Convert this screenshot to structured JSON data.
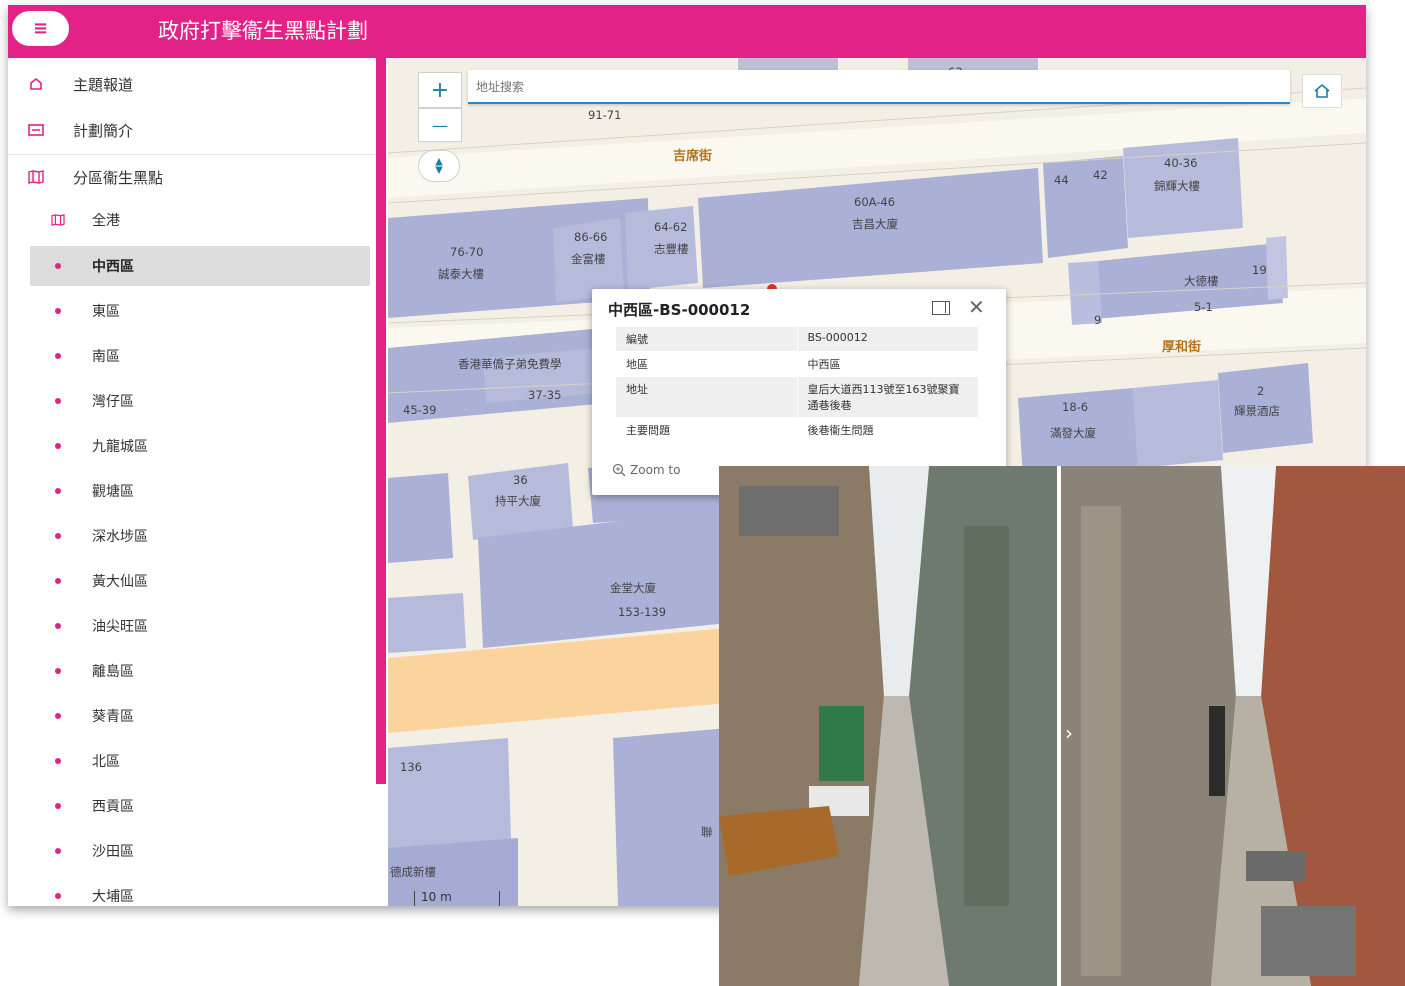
{
  "header": {
    "menu_icon": "hamburger-menu-icon",
    "title": "政府打擊衞生黑點計劃"
  },
  "sidebar": {
    "items": [
      {
        "label": "主題報道",
        "icon": "home-icon"
      },
      {
        "label": "計劃簡介",
        "icon": "card-icon"
      },
      {
        "label": "分區衞生黑點",
        "icon": "map-icon"
      }
    ],
    "districts": [
      {
        "label": "全港",
        "icon": "map-icon",
        "active": false
      },
      {
        "label": "中西區",
        "active": true
      },
      {
        "label": "東區",
        "active": false
      },
      {
        "label": "南區",
        "active": false
      },
      {
        "label": "灣仔區",
        "active": false
      },
      {
        "label": "九龍城區",
        "active": false
      },
      {
        "label": "觀塘區",
        "active": false
      },
      {
        "label": "深水埗區",
        "active": false
      },
      {
        "label": "黃大仙區",
        "active": false
      },
      {
        "label": "油尖旺區",
        "active": false
      },
      {
        "label": "離島區",
        "active": false
      },
      {
        "label": "葵青區",
        "active": false
      },
      {
        "label": "北區",
        "active": false
      },
      {
        "label": "西貢區",
        "active": false
      },
      {
        "label": "沙田區",
        "active": false
      },
      {
        "label": "大埔區",
        "active": false
      }
    ]
  },
  "map": {
    "search": {
      "placeholder": "地址搜索"
    },
    "controls": {
      "zoom_in": "+",
      "zoom_out": "—",
      "compass_icon": "compass-icon",
      "home_icon": "home-icon"
    },
    "scale": "10 m",
    "labels": {
      "n63": "63",
      "n9171": "91-71",
      "road1": "吉席街",
      "n4436": "40-36",
      "b1": "錦輝大樓",
      "n44": "44",
      "n42": "42",
      "n6046": "60A-46",
      "b2": "吉昌大廈",
      "n8666": "86-66",
      "b3": "金富樓",
      "n6462": "64-62",
      "b4": "志豐樓",
      "n7670": "76-70",
      "b5": "誠泰大樓",
      "b6": "大德樓",
      "n19": "19",
      "n51": "5-1",
      "n9": "9",
      "road2": "厚和街",
      "b7": "香港華僑子弟免費學",
      "n3735": "37-35",
      "n4539": "45-39",
      "n2": "2",
      "b8": "輝景酒店",
      "n186": "18-6",
      "b9": "滿發大廈",
      "n36": "36",
      "b10": "持平大廈",
      "b11": "金堂大廈",
      "n153": "153-139",
      "n136": "136",
      "b12": "聯",
      "b13": "德成新樓"
    }
  },
  "popup": {
    "title": "中西區-BS-000012",
    "rows": [
      {
        "key": "編號",
        "value": "BS-000012"
      },
      {
        "key": "地區",
        "value": "中西區"
      },
      {
        "key": "地址",
        "value": "皇后大道西113號至163號聚寶通巷後巷"
      },
      {
        "key": "主要問題",
        "value": "後巷衞生問題"
      }
    ],
    "zoom_to": "Zoom to"
  },
  "photos": {
    "next_icon": "chevron-right-icon"
  },
  "colors": {
    "accent": "#e22286",
    "map_bg": "#f3eee2",
    "building": "#aab0d6",
    "block_dark": "#c6c2d8"
  }
}
